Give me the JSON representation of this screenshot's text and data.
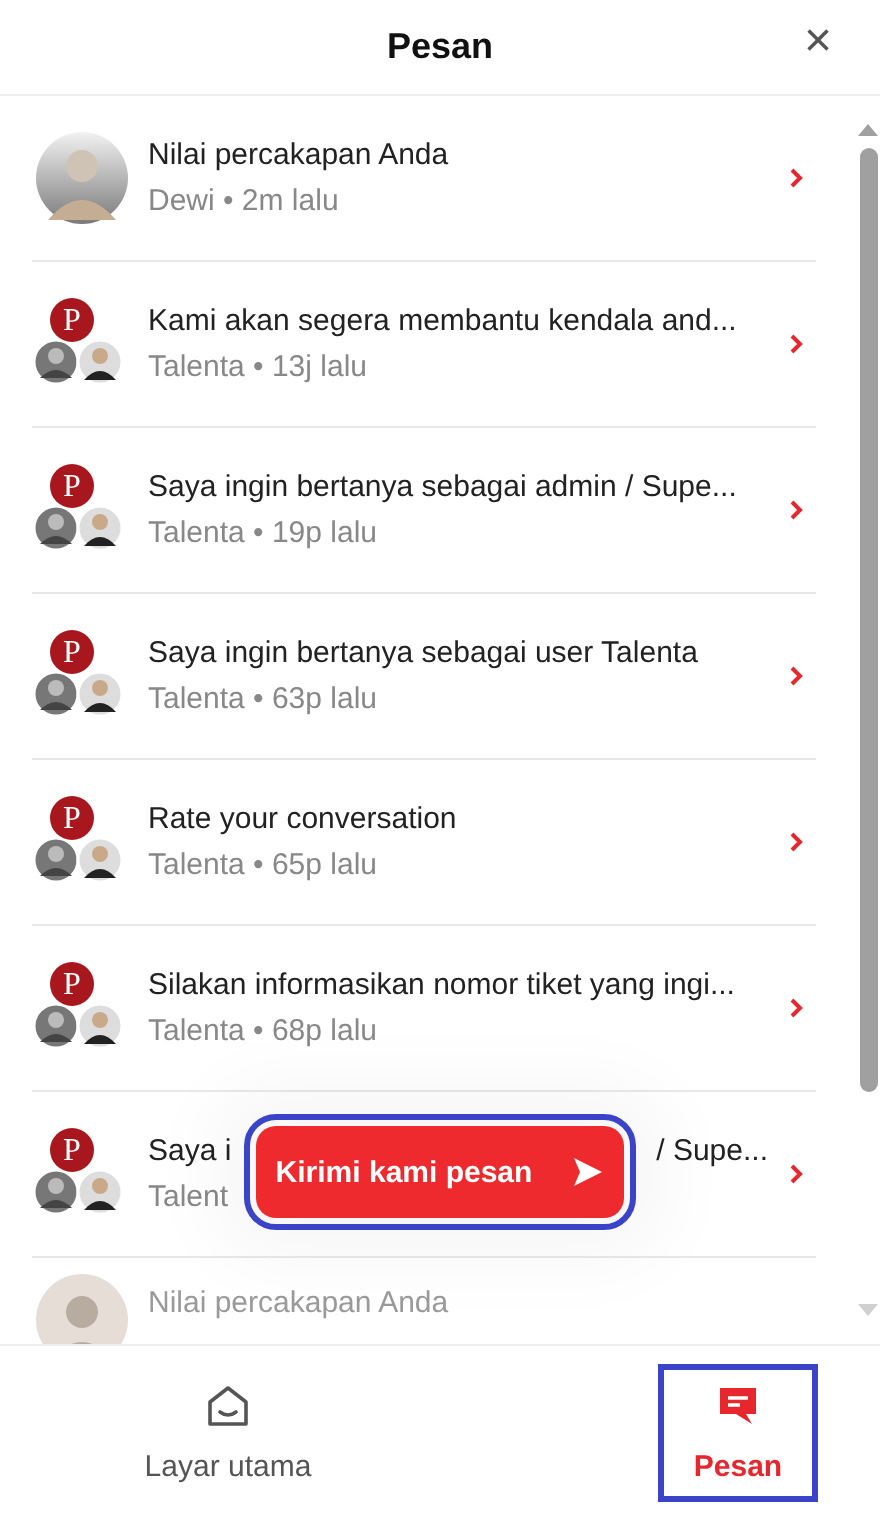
{
  "header": {
    "title": "Pesan",
    "close": "×"
  },
  "messages": [
    {
      "kind": "single",
      "title": "Nilai percakapan Anda",
      "meta": "Dewi • 2m lalu"
    },
    {
      "kind": "group",
      "badge": "P",
      "title": "Kami akan segera membantu kendala and...",
      "meta": "Talenta • 13j lalu"
    },
    {
      "kind": "group",
      "badge": "P",
      "title": "Saya ingin bertanya sebagai admin / Supe...",
      "meta": "Talenta • 19p lalu"
    },
    {
      "kind": "group",
      "badge": "P",
      "title": "Saya ingin bertanya sebagai user Talenta",
      "meta": "Talenta • 63p lalu"
    },
    {
      "kind": "group",
      "badge": "P",
      "title": "Rate your conversation",
      "meta": "Talenta • 65p lalu"
    },
    {
      "kind": "group",
      "badge": "P",
      "title": "Silakan informasikan nomor tiket yang ingi...",
      "meta": "Talenta • 68p lalu"
    },
    {
      "kind": "covered",
      "badge": "P",
      "title_start": "Saya i",
      "title_end": "/ Supe...",
      "meta": "Talent"
    },
    {
      "kind": "faded",
      "title": "Nilai percakapan Anda"
    }
  ],
  "send_button": {
    "label": "Kirimi kami pesan",
    "highlighted": true
  },
  "nav": [
    {
      "label": "Layar utama",
      "selected": false,
      "highlighted": false
    },
    {
      "label": "Pesan",
      "selected": true,
      "highlighted": true
    }
  ]
}
